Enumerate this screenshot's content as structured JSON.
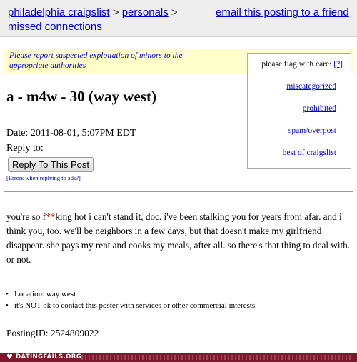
{
  "breadcrumb": {
    "site": "philadelphia craigslist",
    "sep1": ">",
    "section": "personals",
    "sep2": ">",
    "category": "missed connections"
  },
  "email_link": "email this posting to a friend",
  "warning_text": "Please report suspected exploitation of minors to the appropriate authorities",
  "flag_box": {
    "heading": "please flag with care:",
    "help": "[?]",
    "items": [
      "miscategorized",
      "prohibited",
      "spam/overpost",
      "best of craigslist"
    ]
  },
  "post": {
    "title": "a - m4w - 30 (way west)",
    "date": "Date: 2011-08-01, 5:07PM EDT",
    "reply_to": "Reply to:",
    "reply_button": "Reply To This Post",
    "errors_link": "[Errors when replying to ads?]",
    "body_pre": "you're so f",
    "body_censor": "**",
    "body_post": "king hot i can't stand it, doc. i've been stalking you for years from afar. and i think you, too. we'll be neighbors in a few days, but that doesn't make my girlfriend disappear. she pays my rent and cooks my meals, after all. so there's that thing to deal with. or not.",
    "bullets": [
      "Location: way west",
      "it's NOT ok to contact this poster with services or other commercial interests"
    ],
    "posting_id": "PostingID: 2524809022"
  },
  "footer": {
    "brand": "DATINGFAILS.ORG",
    "heart_icon": "heart-icon",
    "bg_color": "#7a1a2c"
  }
}
